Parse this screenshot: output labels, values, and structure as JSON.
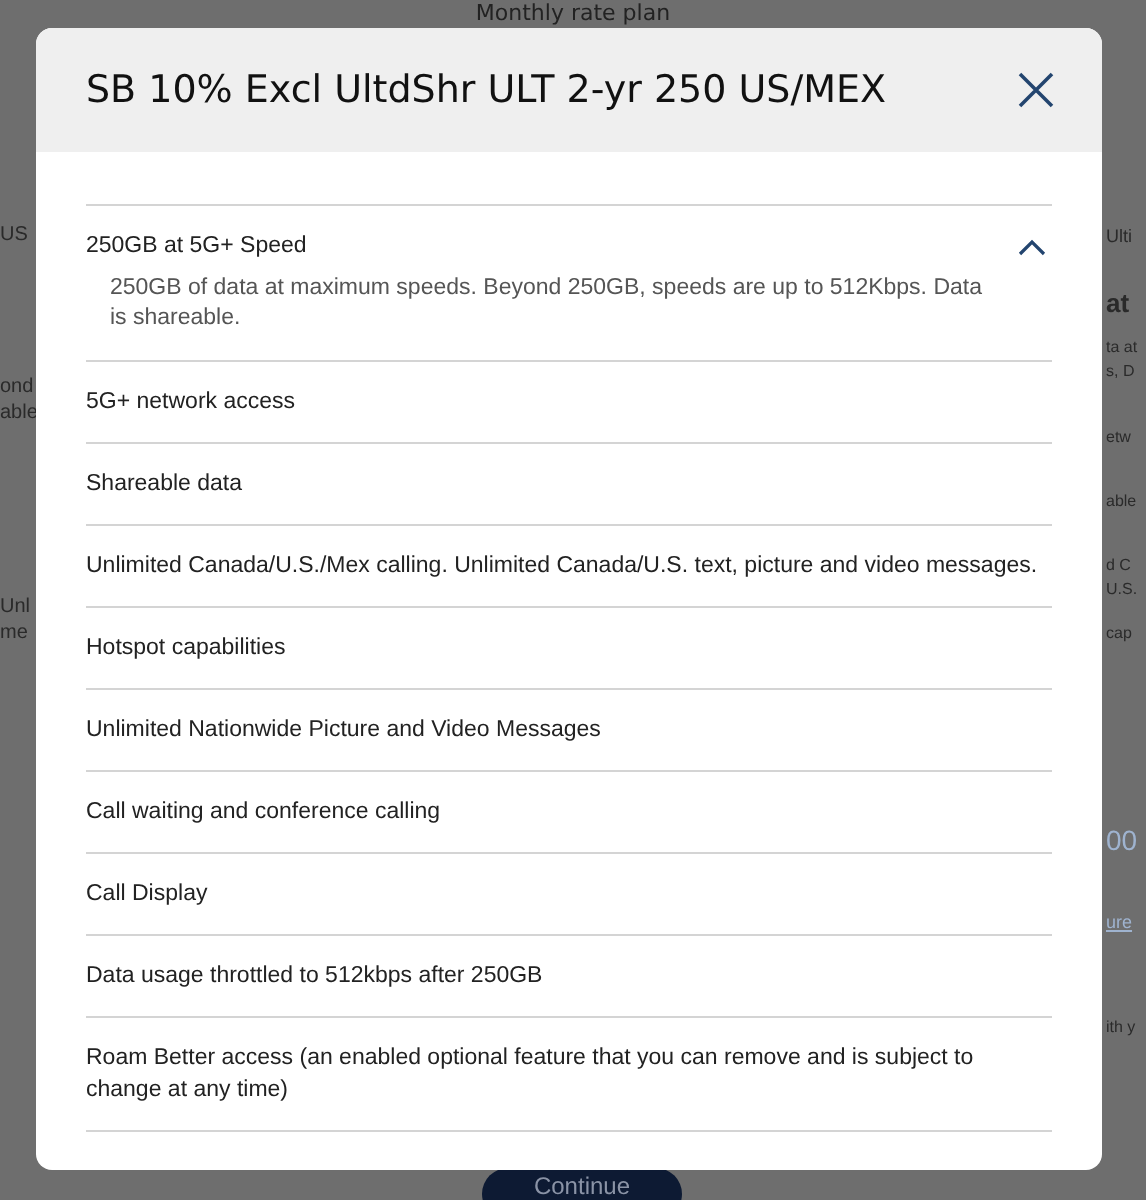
{
  "background": {
    "title": "Monthly rate plan",
    "left_fragments": [
      "US",
      "ond",
      "able",
      "Unl",
      "me"
    ],
    "right_fragments": [
      "Ulti",
      "at",
      "ta at",
      "s, D",
      "etw",
      "able",
      "d C",
      "U.S.",
      "cap",
      "00",
      "ure",
      "ith y"
    ],
    "button": "Continue"
  },
  "dialog": {
    "title": "SB 10% Excl UltdShr ULT 2-yr 250 US/MEX",
    "features": [
      {
        "title": "250GB at 5G+ Speed",
        "expanded": true,
        "description": "250GB of data at maximum speeds. Beyond 250GB, speeds are up to 512Kbps. Data is shareable."
      },
      {
        "title": "5G+ network access",
        "expanded": false
      },
      {
        "title": "Shareable data",
        "expanded": false
      },
      {
        "title": "Unlimited Canada/U.S./Mex calling. Unlimited Canada/U.S. text, picture and video messages.",
        "expanded": false
      },
      {
        "title": "Hotspot capabilities",
        "expanded": false
      },
      {
        "title": "Unlimited Nationwide Picture and Video Messages",
        "expanded": false
      },
      {
        "title": "Call waiting and conference calling",
        "expanded": false
      },
      {
        "title": "Call Display",
        "expanded": false
      },
      {
        "title": "Data usage throttled to 512kbps after 250GB",
        "expanded": false
      },
      {
        "title": "Roam Better access (an enabled optional feature that you can remove and is subject to change at any time)",
        "expanded": false
      }
    ]
  }
}
